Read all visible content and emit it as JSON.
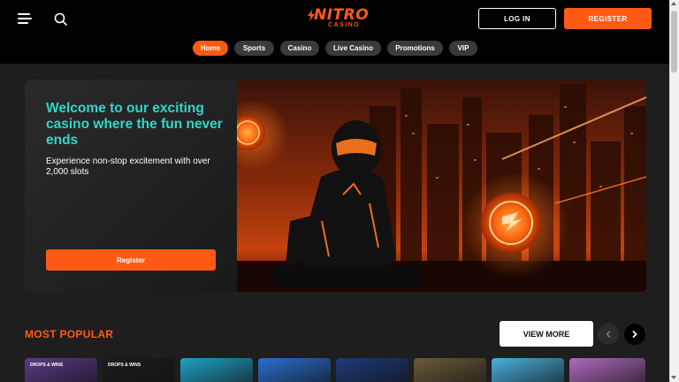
{
  "header": {
    "logo_main": "NITRO",
    "logo_sub": "CASINO",
    "login_label": "LOG IN",
    "register_label": "REGISTER"
  },
  "nav": {
    "items": [
      {
        "label": "Home",
        "active": true
      },
      {
        "label": "Sports",
        "active": false
      },
      {
        "label": "Casino",
        "active": false
      },
      {
        "label": "Live Casino",
        "active": false
      },
      {
        "label": "Promotions",
        "active": false
      },
      {
        "label": "VIP",
        "active": false
      }
    ]
  },
  "hero": {
    "title": "Welcome to our exciting casino where the fun never ends",
    "subtitle": "Experience non-stop excitement with over 2,000 slots",
    "button_label": "Register"
  },
  "popular": {
    "title": "MOST POPULAR",
    "view_more_label": "VIEW MORE",
    "tiles": [
      {
        "label": "DROPS & WINS",
        "icon": "game-tile",
        "color": "#5a3c8a"
      },
      {
        "label": "DROPS & WINS",
        "icon": "game-tile",
        "color": "#1c1c1c"
      },
      {
        "label": "",
        "icon": "game-tile",
        "color": "#1fa2c8"
      },
      {
        "label": "",
        "icon": "game-tile",
        "color": "#2a6fd0"
      },
      {
        "label": "",
        "icon": "game-tile",
        "color": "#1d3a7a"
      },
      {
        "label": "",
        "icon": "game-tile",
        "color": "#6a5a3a"
      },
      {
        "label": "",
        "icon": "game-tile",
        "color": "#4ab0e0"
      },
      {
        "label": "",
        "icon": "game-tile",
        "color": "#b06ac0"
      },
      {
        "label": "",
        "icon": "game-tile",
        "color": "#7a5a2a"
      }
    ]
  },
  "colors": {
    "accent": "#ff5a14",
    "hero_title": "#2ed8c8",
    "header_bg": "#000000",
    "page_bg": "#1e1e1e"
  }
}
